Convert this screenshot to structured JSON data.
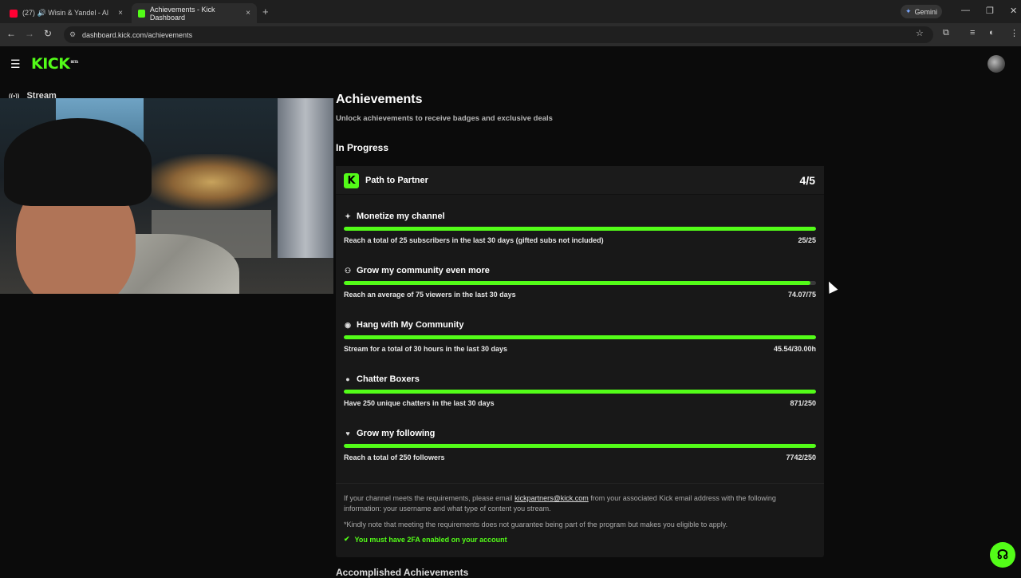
{
  "browser": {
    "tabs": [
      {
        "label": "(27) 🔊 Wisin & Yandel - Al",
        "favicon_color": "#ff0033"
      },
      {
        "label": "Achievements - Kick Dashboard",
        "favicon_color": "#53fc18"
      }
    ],
    "close_glyph": "×",
    "new_tab_glyph": "+",
    "gemini_label": "Gemini",
    "url": "dashboard.kick.com/achievements",
    "nav_icons": [
      "back-icon",
      "forward-icon",
      "reload-icon"
    ],
    "window_controls": [
      "minimize-icon",
      "restore-icon",
      "close-icon"
    ]
  },
  "header": {
    "logo": "KICK",
    "logo_sup": "BETA"
  },
  "sidebar": {
    "item": "Stream"
  },
  "main": {
    "title": "Achievements",
    "subtitle": "Unlock achievements to receive badges and exclusive deals",
    "section": "In Progress",
    "card": {
      "badge": "K",
      "title": "Path to Partner",
      "count": "4/5",
      "items": [
        {
          "icon": "sparkle-icon",
          "glyph": "✦",
          "title": "Monetize my channel",
          "desc": "Reach a total of 25 subscribers in the last 30 days (gifted subs not included)",
          "value": "25/25",
          "progress": 1.0
        },
        {
          "icon": "community-icon",
          "glyph": "⚇",
          "title": "Grow my community even more",
          "desc": "Reach an average of 75 viewers in the last 30 days",
          "value": "74.07/75",
          "progress": 0.988
        },
        {
          "icon": "broadcast-icon",
          "glyph": "◉",
          "title": "Hang with My Community",
          "desc": "Stream for a total of 30 hours in the last 30 days",
          "value": "45.54/30.00h",
          "progress": 1.0
        },
        {
          "icon": "chat-icon",
          "glyph": "●",
          "title": "Chatter Boxers",
          "desc": "Have 250 unique chatters in the last 30 days",
          "value": "871/250",
          "progress": 1.0
        },
        {
          "icon": "heart-icon",
          "glyph": "♥",
          "title": "Grow my following",
          "desc": "Reach a total of 250 followers",
          "value": "7742/250",
          "progress": 1.0
        }
      ],
      "footer": {
        "line1_pre": "If your channel meets the requirements, please email ",
        "email": "kickpartners@kick.com",
        "line1_post": " from your associated Kick email address with the following information: your username and what type of content you stream.",
        "note": "*Kindly note that meeting the requirements does not guarantee being part of the program but makes you eligible to apply.",
        "check_glyph": "✔",
        "requirement": "You must have 2FA enabled on your account"
      }
    },
    "next_section": "Accomplished Achievements"
  },
  "colors": {
    "accent": "#53fc18",
    "background": "#0b0b0b",
    "card": "#181818"
  }
}
